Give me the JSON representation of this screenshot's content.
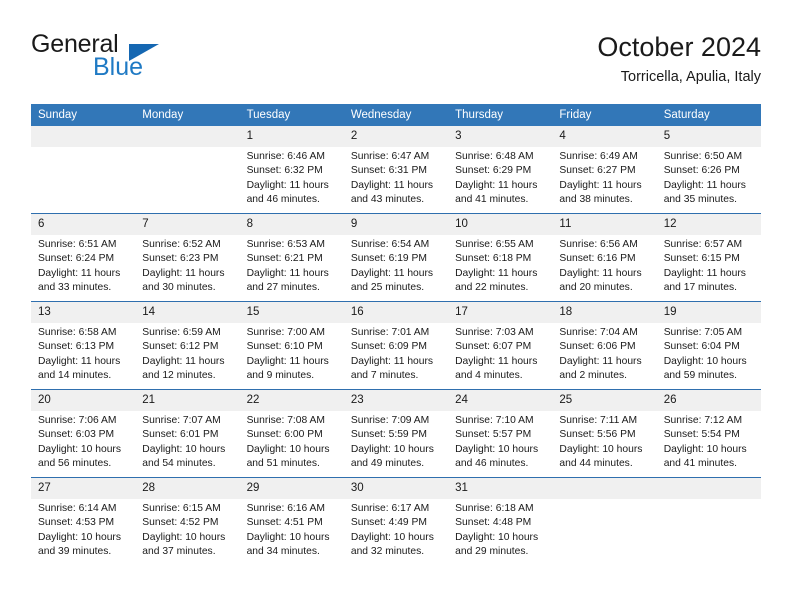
{
  "brand": {
    "line1": "General",
    "line2": "Blue",
    "triangle_color": "#1567b2",
    "blue_text_color": "#1f7ac4"
  },
  "header": {
    "title": "October 2024",
    "subtitle": "Torricella, Apulia, Italy"
  },
  "theme": {
    "header_bg": "#3277b8",
    "row_divider": "#2f6fae",
    "daynum_bg": "#f0f0f0",
    "text": "#1a1a1a"
  },
  "calendar": {
    "weekday_headers": [
      "Sunday",
      "Monday",
      "Tuesday",
      "Wednesday",
      "Thursday",
      "Friday",
      "Saturday"
    ],
    "weeks": [
      [
        {
          "day": "",
          "empty": true,
          "sunrise": "",
          "sunset": "",
          "daylight_line1": "",
          "daylight_line2": ""
        },
        {
          "day": "",
          "empty": true,
          "sunrise": "",
          "sunset": "",
          "daylight_line1": "",
          "daylight_line2": ""
        },
        {
          "day": "1",
          "sunrise": "Sunrise: 6:46 AM",
          "sunset": "Sunset: 6:32 PM",
          "daylight_line1": "Daylight: 11 hours",
          "daylight_line2": "and 46 minutes."
        },
        {
          "day": "2",
          "sunrise": "Sunrise: 6:47 AM",
          "sunset": "Sunset: 6:31 PM",
          "daylight_line1": "Daylight: 11 hours",
          "daylight_line2": "and 43 minutes."
        },
        {
          "day": "3",
          "sunrise": "Sunrise: 6:48 AM",
          "sunset": "Sunset: 6:29 PM",
          "daylight_line1": "Daylight: 11 hours",
          "daylight_line2": "and 41 minutes."
        },
        {
          "day": "4",
          "sunrise": "Sunrise: 6:49 AM",
          "sunset": "Sunset: 6:27 PM",
          "daylight_line1": "Daylight: 11 hours",
          "daylight_line2": "and 38 minutes."
        },
        {
          "day": "5",
          "sunrise": "Sunrise: 6:50 AM",
          "sunset": "Sunset: 6:26 PM",
          "daylight_line1": "Daylight: 11 hours",
          "daylight_line2": "and 35 minutes."
        }
      ],
      [
        {
          "day": "6",
          "sunrise": "Sunrise: 6:51 AM",
          "sunset": "Sunset: 6:24 PM",
          "daylight_line1": "Daylight: 11 hours",
          "daylight_line2": "and 33 minutes."
        },
        {
          "day": "7",
          "sunrise": "Sunrise: 6:52 AM",
          "sunset": "Sunset: 6:23 PM",
          "daylight_line1": "Daylight: 11 hours",
          "daylight_line2": "and 30 minutes."
        },
        {
          "day": "8",
          "sunrise": "Sunrise: 6:53 AM",
          "sunset": "Sunset: 6:21 PM",
          "daylight_line1": "Daylight: 11 hours",
          "daylight_line2": "and 27 minutes."
        },
        {
          "day": "9",
          "sunrise": "Sunrise: 6:54 AM",
          "sunset": "Sunset: 6:19 PM",
          "daylight_line1": "Daylight: 11 hours",
          "daylight_line2": "and 25 minutes."
        },
        {
          "day": "10",
          "sunrise": "Sunrise: 6:55 AM",
          "sunset": "Sunset: 6:18 PM",
          "daylight_line1": "Daylight: 11 hours",
          "daylight_line2": "and 22 minutes."
        },
        {
          "day": "11",
          "sunrise": "Sunrise: 6:56 AM",
          "sunset": "Sunset: 6:16 PM",
          "daylight_line1": "Daylight: 11 hours",
          "daylight_line2": "and 20 minutes."
        },
        {
          "day": "12",
          "sunrise": "Sunrise: 6:57 AM",
          "sunset": "Sunset: 6:15 PM",
          "daylight_line1": "Daylight: 11 hours",
          "daylight_line2": "and 17 minutes."
        }
      ],
      [
        {
          "day": "13",
          "sunrise": "Sunrise: 6:58 AM",
          "sunset": "Sunset: 6:13 PM",
          "daylight_line1": "Daylight: 11 hours",
          "daylight_line2": "and 14 minutes."
        },
        {
          "day": "14",
          "sunrise": "Sunrise: 6:59 AM",
          "sunset": "Sunset: 6:12 PM",
          "daylight_line1": "Daylight: 11 hours",
          "daylight_line2": "and 12 minutes."
        },
        {
          "day": "15",
          "sunrise": "Sunrise: 7:00 AM",
          "sunset": "Sunset: 6:10 PM",
          "daylight_line1": "Daylight: 11 hours",
          "daylight_line2": "and 9 minutes."
        },
        {
          "day": "16",
          "sunrise": "Sunrise: 7:01 AM",
          "sunset": "Sunset: 6:09 PM",
          "daylight_line1": "Daylight: 11 hours",
          "daylight_line2": "and 7 minutes."
        },
        {
          "day": "17",
          "sunrise": "Sunrise: 7:03 AM",
          "sunset": "Sunset: 6:07 PM",
          "daylight_line1": "Daylight: 11 hours",
          "daylight_line2": "and 4 minutes."
        },
        {
          "day": "18",
          "sunrise": "Sunrise: 7:04 AM",
          "sunset": "Sunset: 6:06 PM",
          "daylight_line1": "Daylight: 11 hours",
          "daylight_line2": "and 2 minutes."
        },
        {
          "day": "19",
          "sunrise": "Sunrise: 7:05 AM",
          "sunset": "Sunset: 6:04 PM",
          "daylight_line1": "Daylight: 10 hours",
          "daylight_line2": "and 59 minutes."
        }
      ],
      [
        {
          "day": "20",
          "sunrise": "Sunrise: 7:06 AM",
          "sunset": "Sunset: 6:03 PM",
          "daylight_line1": "Daylight: 10 hours",
          "daylight_line2": "and 56 minutes."
        },
        {
          "day": "21",
          "sunrise": "Sunrise: 7:07 AM",
          "sunset": "Sunset: 6:01 PM",
          "daylight_line1": "Daylight: 10 hours",
          "daylight_line2": "and 54 minutes."
        },
        {
          "day": "22",
          "sunrise": "Sunrise: 7:08 AM",
          "sunset": "Sunset: 6:00 PM",
          "daylight_line1": "Daylight: 10 hours",
          "daylight_line2": "and 51 minutes."
        },
        {
          "day": "23",
          "sunrise": "Sunrise: 7:09 AM",
          "sunset": "Sunset: 5:59 PM",
          "daylight_line1": "Daylight: 10 hours",
          "daylight_line2": "and 49 minutes."
        },
        {
          "day": "24",
          "sunrise": "Sunrise: 7:10 AM",
          "sunset": "Sunset: 5:57 PM",
          "daylight_line1": "Daylight: 10 hours",
          "daylight_line2": "and 46 minutes."
        },
        {
          "day": "25",
          "sunrise": "Sunrise: 7:11 AM",
          "sunset": "Sunset: 5:56 PM",
          "daylight_line1": "Daylight: 10 hours",
          "daylight_line2": "and 44 minutes."
        },
        {
          "day": "26",
          "sunrise": "Sunrise: 7:12 AM",
          "sunset": "Sunset: 5:54 PM",
          "daylight_line1": "Daylight: 10 hours",
          "daylight_line2": "and 41 minutes."
        }
      ],
      [
        {
          "day": "27",
          "sunrise": "Sunrise: 6:14 AM",
          "sunset": "Sunset: 4:53 PM",
          "daylight_line1": "Daylight: 10 hours",
          "daylight_line2": "and 39 minutes."
        },
        {
          "day": "28",
          "sunrise": "Sunrise: 6:15 AM",
          "sunset": "Sunset: 4:52 PM",
          "daylight_line1": "Daylight: 10 hours",
          "daylight_line2": "and 37 minutes."
        },
        {
          "day": "29",
          "sunrise": "Sunrise: 6:16 AM",
          "sunset": "Sunset: 4:51 PM",
          "daylight_line1": "Daylight: 10 hours",
          "daylight_line2": "and 34 minutes."
        },
        {
          "day": "30",
          "sunrise": "Sunrise: 6:17 AM",
          "sunset": "Sunset: 4:49 PM",
          "daylight_line1": "Daylight: 10 hours",
          "daylight_line2": "and 32 minutes."
        },
        {
          "day": "31",
          "sunrise": "Sunrise: 6:18 AM",
          "sunset": "Sunset: 4:48 PM",
          "daylight_line1": "Daylight: 10 hours",
          "daylight_line2": "and 29 minutes."
        },
        {
          "day": "",
          "empty": true,
          "sunrise": "",
          "sunset": "",
          "daylight_line1": "",
          "daylight_line2": ""
        },
        {
          "day": "",
          "empty": true,
          "sunrise": "",
          "sunset": "",
          "daylight_line1": "",
          "daylight_line2": ""
        }
      ]
    ]
  }
}
